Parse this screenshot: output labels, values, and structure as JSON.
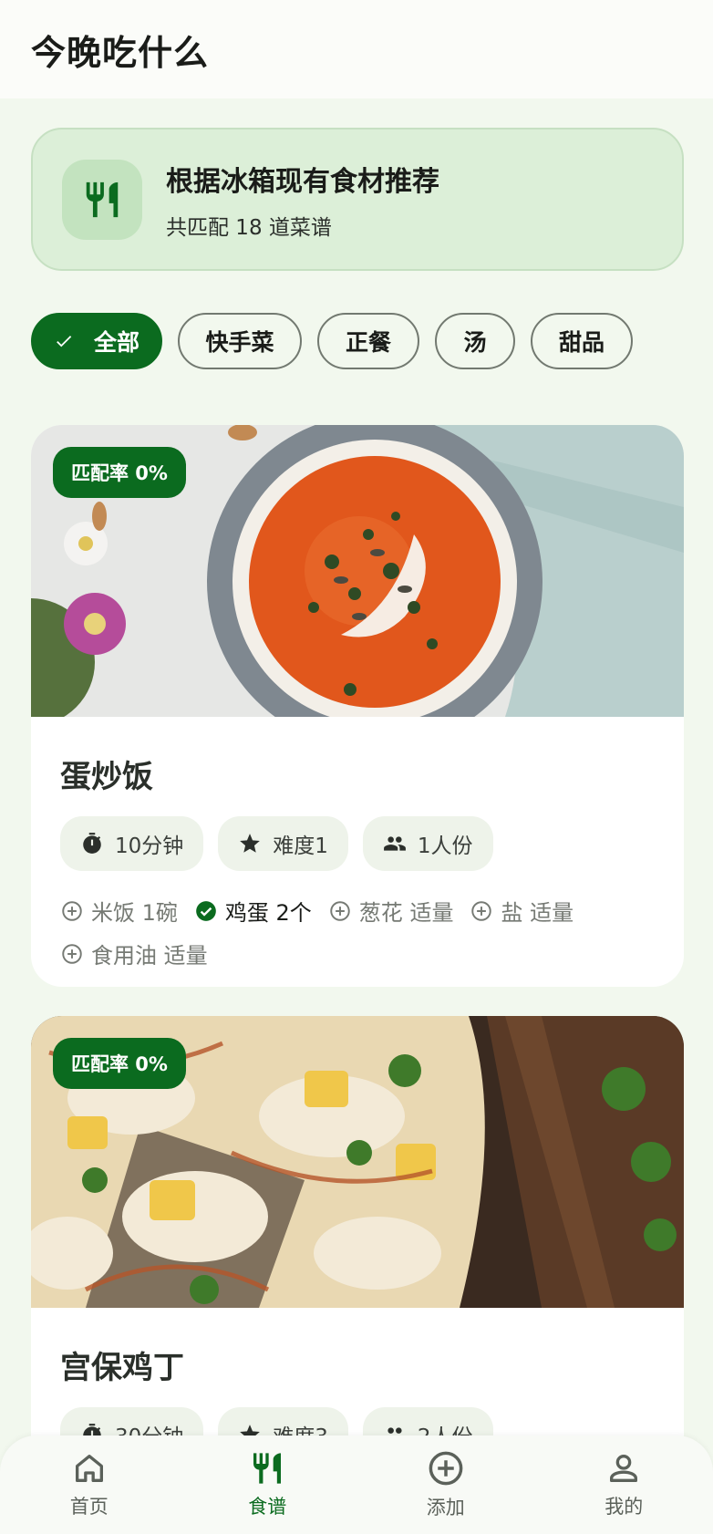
{
  "app_title": "今晚吃什么",
  "banner": {
    "icon": "utensils-icon",
    "title": "根据冰箱现有食材推荐",
    "subtitle": "共匹配 18 道菜谱"
  },
  "filters": [
    {
      "label": "全部",
      "selected": true
    },
    {
      "label": "快手菜",
      "selected": false
    },
    {
      "label": "正餐",
      "selected": false
    },
    {
      "label": "汤",
      "selected": false
    },
    {
      "label": "甜品",
      "selected": false
    }
  ],
  "recipes": [
    {
      "badge": "匹配率 0%",
      "image": "tomato-soup-photo",
      "title": "蛋炒饭",
      "time": "10分钟",
      "difficulty": "难度1",
      "servings": "1人份",
      "ingredients": [
        {
          "text": "米饭 1碗",
          "have": false
        },
        {
          "text": "鸡蛋 2个",
          "have": true
        },
        {
          "text": "葱花 适量",
          "have": false
        },
        {
          "text": "盐 适量",
          "have": false
        },
        {
          "text": "食用油 适量",
          "have": false
        }
      ]
    },
    {
      "badge": "匹配率 0%",
      "image": "pizza-photo",
      "title": "宫保鸡丁",
      "time": "30分钟",
      "difficulty": "难度3",
      "servings": "2人份"
    }
  ],
  "nav": [
    {
      "label": "首页",
      "icon": "home-icon",
      "active": false
    },
    {
      "label": "食谱",
      "icon": "utensils-icon",
      "active": true
    },
    {
      "label": "添加",
      "icon": "add-circle-icon",
      "active": false
    },
    {
      "label": "我的",
      "icon": "person-icon",
      "active": false
    }
  ],
  "colors": {
    "primary": "#0b6b1f",
    "background": "#f2f8ee",
    "banner": "#dcefd8"
  }
}
